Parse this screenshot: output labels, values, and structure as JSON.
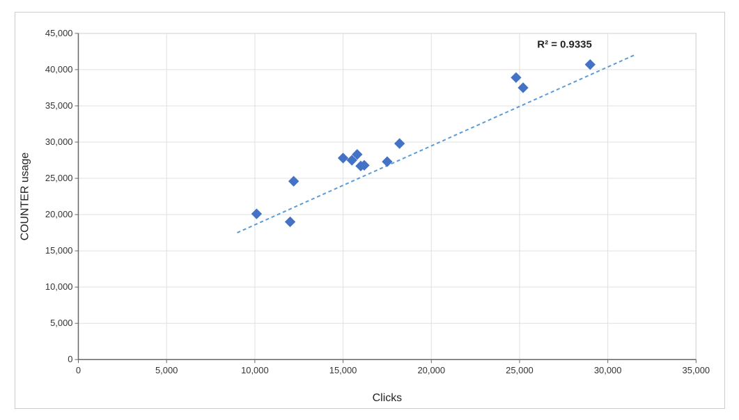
{
  "chart": {
    "title": "",
    "x_axis_label": "Clicks",
    "y_axis_label": "COUNTER usage",
    "r_squared_label": "R² = 0.9335",
    "x_min": 0,
    "x_max": 35000,
    "y_min": 0,
    "y_max": 45000,
    "x_ticks": [
      0,
      5000,
      10000,
      15000,
      20000,
      25000,
      30000,
      35000
    ],
    "y_ticks": [
      0,
      5000,
      10000,
      15000,
      20000,
      25000,
      30000,
      35000,
      40000,
      45000
    ],
    "data_points": [
      {
        "x": 10100,
        "y": 20100
      },
      {
        "x": 12000,
        "y": 19000
      },
      {
        "x": 12200,
        "y": 24600
      },
      {
        "x": 15000,
        "y": 27800
      },
      {
        "x": 15500,
        "y": 27500
      },
      {
        "x": 15800,
        "y": 28300
      },
      {
        "x": 16000,
        "y": 26700
      },
      {
        "x": 16200,
        "y": 26800
      },
      {
        "x": 17500,
        "y": 27300
      },
      {
        "x": 18200,
        "y": 29800
      },
      {
        "x": 24800,
        "y": 38900
      },
      {
        "x": 25200,
        "y": 37500
      },
      {
        "x": 29000,
        "y": 40700
      }
    ],
    "trendline": {
      "x1": 9000,
      "y1": 17500,
      "x2": 31500,
      "y2": 42000
    }
  }
}
